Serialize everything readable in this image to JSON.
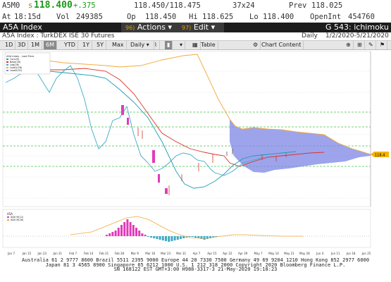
{
  "quote": {
    "ticker": "A5M0",
    "side_marker": "s",
    "last": "118.400",
    "change": "+.375",
    "bid_ask": "118.450/118.475",
    "size": "37x24",
    "prev_label": "Prev",
    "prev": "118.025",
    "time_label": "At",
    "time": "18:15d",
    "vol_label": "Vol",
    "vol": "249385",
    "open_label": "Op",
    "open": "118.450",
    "high_label": "Hi",
    "high": "118.625",
    "low_label": "Lo",
    "low": "118.400",
    "oi_label": "OpenInt",
    "oi": "454760"
  },
  "menubar": {
    "security": "A5A Index",
    "actions_num": "96)",
    "actions_label": "Actions",
    "edit_num": "97)",
    "edit_label": "Edit",
    "page_label": "G 543: ichimoku"
  },
  "titlebar": {
    "title": "A5A Index : TurkDEX ISE 30 Futures",
    "period": "Daily",
    "range": "1/2/2020-5/21/2020"
  },
  "toolbar": {
    "ranges": [
      "1D",
      "3D",
      "1M",
      "6M",
      "YTD",
      "1Y",
      "5Y",
      "Max"
    ],
    "selected": "6M",
    "periodicity": "Daily",
    "table": "Table",
    "chart_content": "Chart Content"
  },
  "legend": {
    "title": "A5A Index - Last Price",
    "items": [
      "Conv(9)",
      "Base(26)",
      "Lag(26)",
      "Lead1(26)",
      "Lead2(52)"
    ]
  },
  "lower_panel": {
    "title": "A5A",
    "items": [
      "ADX M(12)",
      "ADX M(26)"
    ]
  },
  "chart_data": {
    "type": "candlestick-ichimoku",
    "x_ticks": [
      "Jan 7",
      "Jan 15",
      "Jan 23",
      "Jan 31",
      "Feb 7",
      "Feb 14",
      "Feb 21",
      "Feb 28",
      "Mar 9",
      "Mar 16",
      "Mar 23",
      "Mar 31",
      "Apr 7",
      "Apr 15",
      "Apr 22",
      "Apr 29",
      "May 7",
      "May 14",
      "May 21",
      "May 28",
      "Jun 4",
      "Jun 11",
      "Jun 18",
      "Jun 25"
    ],
    "last_price_marker": "118.4",
    "cloud": true,
    "lower_indicator": "MACD histogram"
  },
  "colors": {
    "conv": "#1a9fb0",
    "base": "#d9342b",
    "lag": "#3fa9c4",
    "lead1": "#f2a93b",
    "cloud": "#7c86e6",
    "hist": "#e23ab8",
    "accent": "#f5b400"
  },
  "footer": {
    "line1": "Australia 61 2 9777 8600  Brazil 5511 2395 9000  Europe 44 20 7330 7500  Germany 49 69 9204 1210  Hong Kong 852 2977 6000",
    "line2": "Japan 81 3 4565 8900           Singapore 65 6212 1000           U.S. 1 212 318 2000           Copyright 2020 Bloomberg Finance L.P.",
    "line3": "SN 168122 EST  GMT+3:00 H988-3317-3 21-May-2020 19:18:23"
  }
}
